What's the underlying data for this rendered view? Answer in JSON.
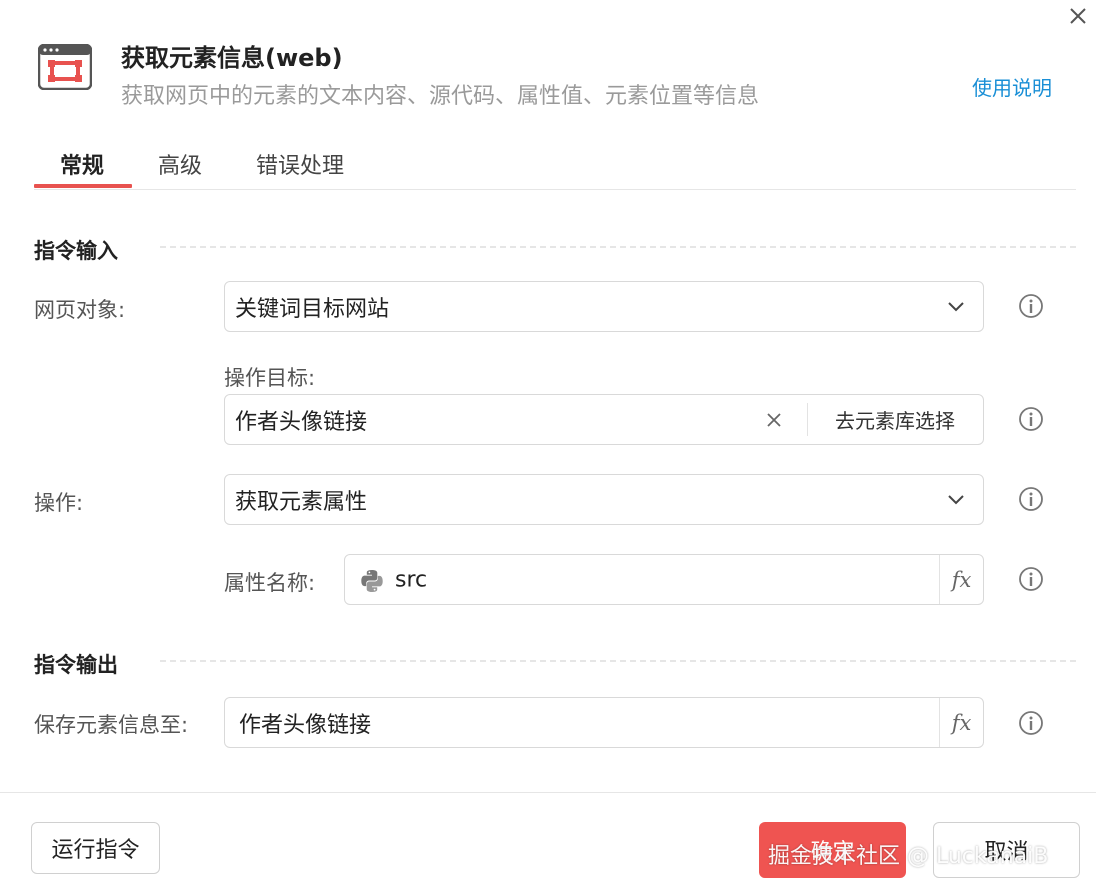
{
  "dialog": {
    "title": "获取元素信息(web)",
    "subtitle": "获取网页中的元素的文本内容、源代码、属性值、元素位置等信息",
    "help_link": "使用说明"
  },
  "tabs": [
    {
      "label": "常规",
      "active": true
    },
    {
      "label": "高级",
      "active": false
    },
    {
      "label": "错误处理",
      "active": false
    }
  ],
  "sections": {
    "input_title": "指令输入",
    "output_title": "指令输出"
  },
  "fields": {
    "web_object": {
      "label": "网页对象:",
      "value": "关键词目标网站"
    },
    "target": {
      "label": "操作目标:",
      "value": "作者头像链接",
      "library_button": "去元素库选择"
    },
    "operation": {
      "label": "操作:",
      "value": "获取元素属性"
    },
    "attr_name": {
      "label": "属性名称:",
      "value": "src",
      "fx": "fx"
    },
    "save_to": {
      "label": "保存元素信息至:",
      "value": "作者头像链接",
      "fx": "fx"
    }
  },
  "footer": {
    "run_button": "运行指令",
    "confirm_button": "确定",
    "cancel_button": "取消",
    "watermark": "掘金技术社区 @ LuckanaiB"
  },
  "colors": {
    "accent": "#ef5451",
    "link": "#1a8fd6"
  }
}
